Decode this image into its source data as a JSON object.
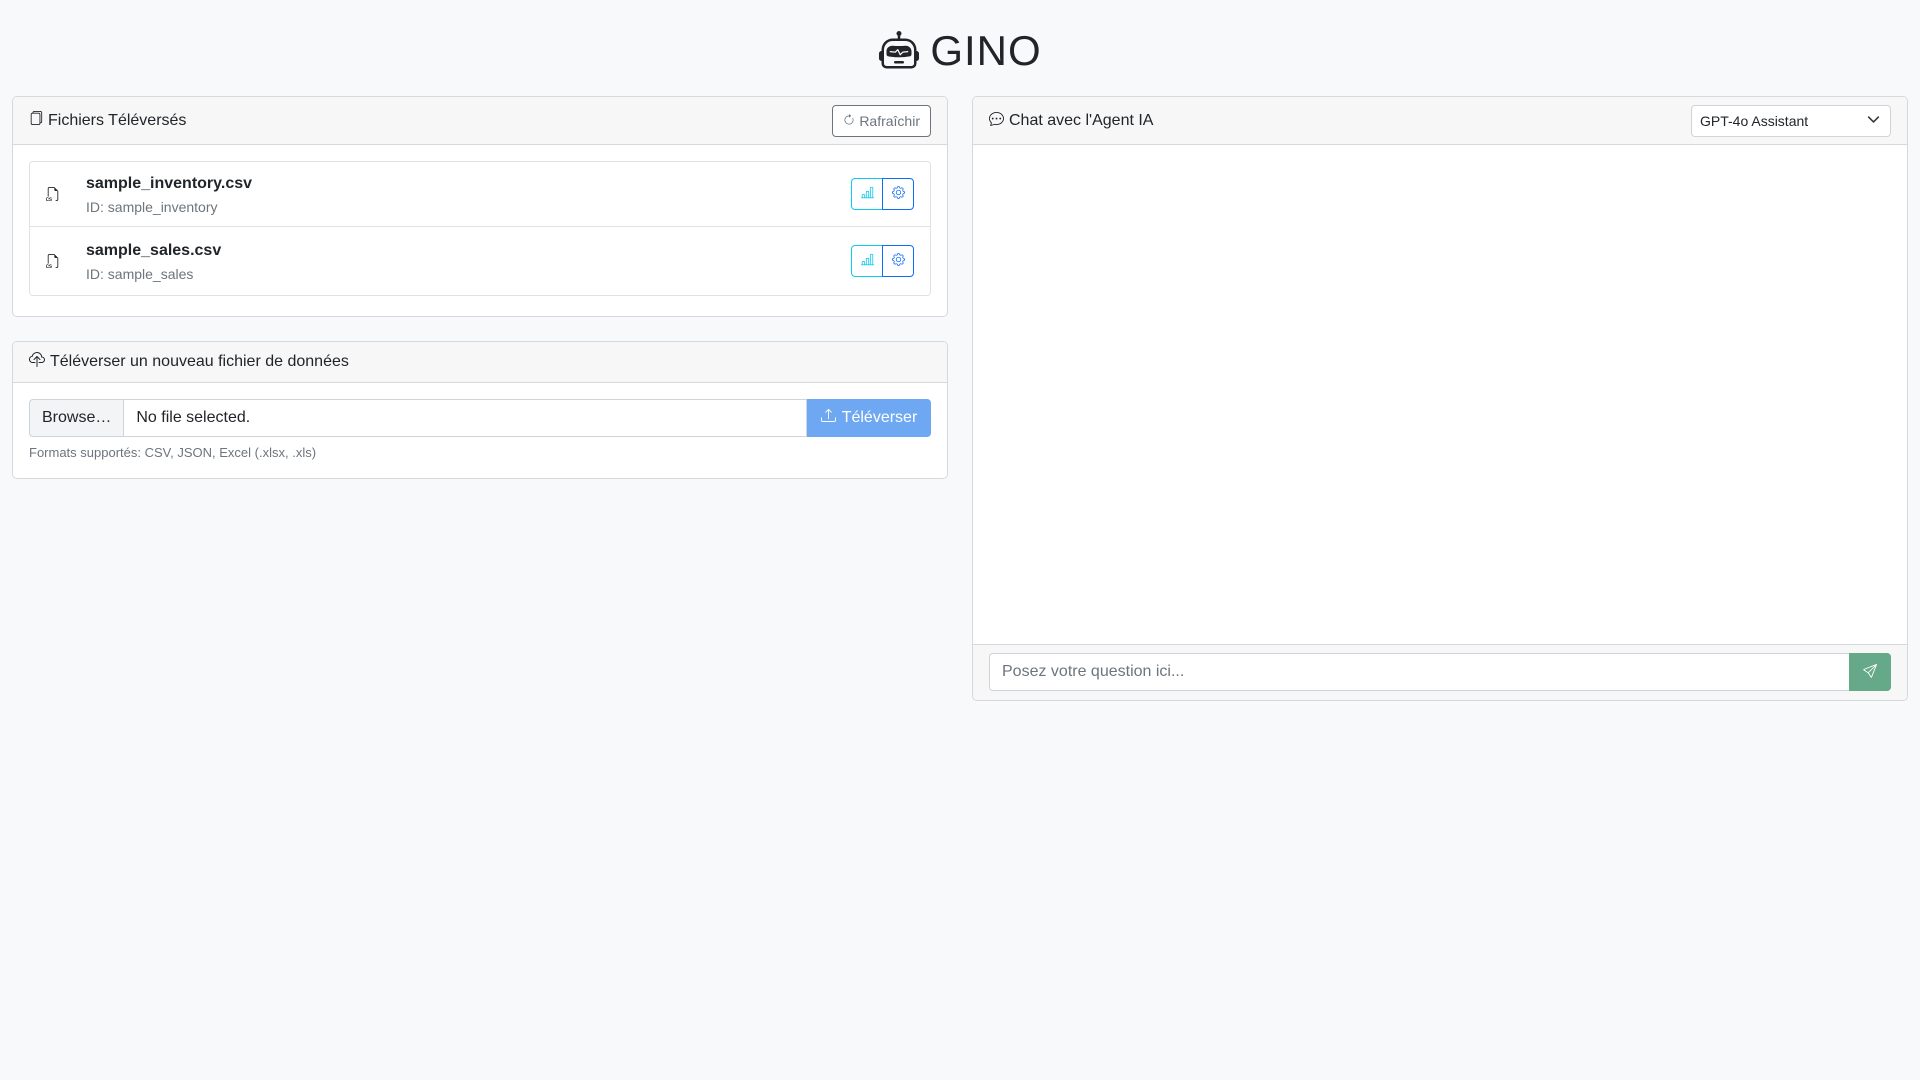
{
  "app": {
    "title": "GINO",
    "logo_icon": "robot-icon"
  },
  "files_panel": {
    "title": "Fichiers Téléversés",
    "title_icon": "files-icon",
    "refresh_label": "Rafraîchir",
    "refresh_icon": "refresh-icon",
    "files": [
      {
        "name": "sample_inventory.csv",
        "id_text": "ID: sample_inventory",
        "icon": "csv-file-icon"
      },
      {
        "name": "sample_sales.csv",
        "id_text": "ID: sample_sales",
        "icon": "csv-file-icon"
      }
    ],
    "action_icons": [
      "bar-chart-icon",
      "gear-icon"
    ]
  },
  "upload_panel": {
    "title": "Téléverser un nouveau fichier de données",
    "title_icon": "cloud-upload-icon",
    "browse_label": "Browse…",
    "file_status": "No file selected.",
    "upload_label": "Téléverser",
    "upload_icon": "upload-icon",
    "help_text": "Formats supportés: CSV, JSON, Excel (.xlsx, .xls)"
  },
  "chat_panel": {
    "title": "Chat avec l'Agent IA",
    "title_icon": "chat-dots-icon",
    "model_selected": "GPT-4o Assistant",
    "input_placeholder": "Posez votre question ici...",
    "send_icon": "send-icon"
  },
  "colors": {
    "background": "#f8f9fa",
    "chart_button": "#0dcaf0",
    "gear_button": "#0d6efd",
    "upload_button": "#6ea8f2",
    "send_button": "#66a989"
  }
}
